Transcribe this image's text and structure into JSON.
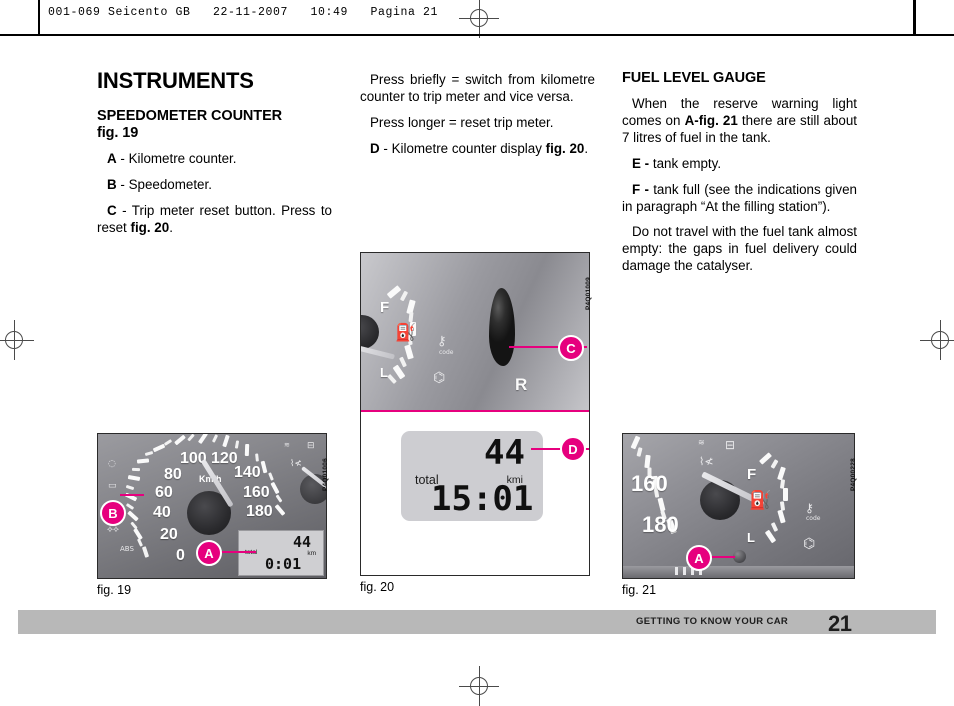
{
  "header": {
    "print_slug": "001-069 Seicento GB   22-11-2007   10:49   Pagina 21"
  },
  "columns": {
    "left": {
      "title": "INSTRUMENTS",
      "section_heading": "SPEEDOMETER COUNTER",
      "section_figref": "fig. 19",
      "items": [
        {
          "letter": "A",
          "text": " - Kilometre counter."
        },
        {
          "letter": "B",
          "text": " - Speedometer."
        },
        {
          "letter": "C",
          "text": " - Trip meter reset button. Press to reset ",
          "bold_tail": "fig. 20",
          "tail": "."
        }
      ]
    },
    "middle": {
      "para1": "Press briefly = switch from kilometre counter to trip meter and vice versa.",
      "para2": "Press longer = reset trip meter.",
      "item_d_letter": "D",
      "item_d_text": " - Kilometre counter display ",
      "item_d_bold": "fig. 20",
      "item_d_tail": "."
    },
    "right": {
      "section_heading": "FUEL LEVEL GAUGE",
      "para1_a": "When the reserve warning light comes on ",
      "para1_bold": "A-fig. 21",
      "para1_b": " there are still about 7 litres of fuel in the tank.",
      "item_e_letter": "E -",
      "item_e_text": " tank empty.",
      "item_f_letter": "F -",
      "item_f_text": " tank full (see the indications given in paragraph “At the filling station”).",
      "para_last": "Do not travel with the fuel tank almost empty: the gaps in fuel delivery could damage the catalyser."
    }
  },
  "figures": [
    {
      "id": "fig19",
      "caption": "fig. 19",
      "code": "P4Q01006",
      "callouts": [
        "B",
        "A"
      ],
      "speed_ticks": [
        "0",
        "20",
        "40",
        "60",
        "80",
        "100",
        "120",
        "140",
        "160",
        "180"
      ],
      "unit_label": "Km/h",
      "lcd": {
        "total_label": "total",
        "unit": "km",
        "trip_value": "44",
        "odo_value": "0:01"
      }
    },
    {
      "id": "fig20",
      "caption": "fig. 20",
      "code": "P4Q01009",
      "callouts": [
        "C",
        "D"
      ],
      "fuel_high": "F",
      "fuel_low": "L",
      "gear_label": "R",
      "key_label": "code",
      "lcd": {
        "total_label": "total",
        "unit": "kmi",
        "trip_value": "44",
        "odo_value": "15:01"
      }
    },
    {
      "id": "fig21",
      "caption": "fig. 21",
      "code": "P4Q00228",
      "callouts": [
        "A"
      ],
      "speed_ticks": [
        "160",
        "180"
      ],
      "fuel_high": "F",
      "fuel_low": "L",
      "key_label": "code"
    }
  ],
  "footer": {
    "chapter": "GETTING TO KNOW YOUR CAR",
    "page_number": "21"
  },
  "colors": {
    "callout_magenta": "#e6007e",
    "footer_gray": "#b8b8b8",
    "text_black": "#000000"
  }
}
